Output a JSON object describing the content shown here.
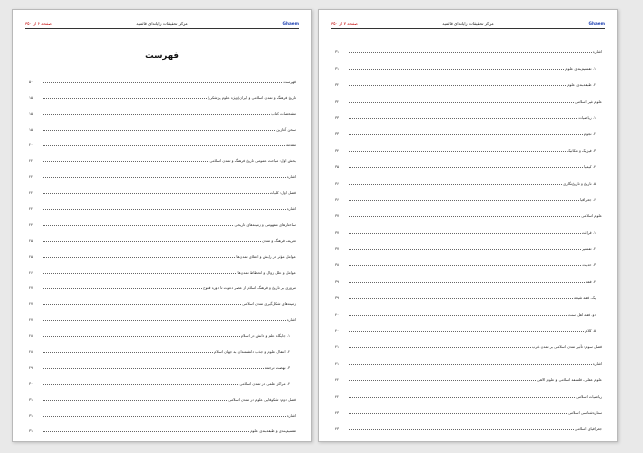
{
  "left_page": {
    "header": {
      "page_label": "صفحه ۶ از ۳۵۰",
      "title": "مرکز تحقیقات رایانه‌ای قائمیه",
      "brand": "Ghaem"
    },
    "toc_title": "فهرست",
    "entries": [
      {
        "text": "فهرست",
        "page": "۵۰"
      },
      {
        "text": "تاریخ فرهنگ و تمدن اسلامی و ایران(ویژه علوم پزشکی)",
        "page": "۱۵"
      },
      {
        "text": "مشخصات کتاب",
        "page": "۱۵"
      },
      {
        "text": "سخن آغازین",
        "page": "۱۵"
      },
      {
        "text": "مقدمه",
        "page": "۲۰"
      },
      {
        "text": "بخش اول: مباحث عمومی تاریخ فرهنگ و تمدن اسلامی",
        "page": "۲۲"
      },
      {
        "text": "اشاره",
        "page": "۲۲"
      },
      {
        "text": "فصل اول: کلیات",
        "page": "۲۲"
      },
      {
        "text": "اشاره",
        "page": "۲۲"
      },
      {
        "text": "ساختارهای مفهومی و زمینه‌های تاریخی",
        "page": "۲۴"
      },
      {
        "text": "تعریف فرهنگ و تمدن",
        "page": "۲۵"
      },
      {
        "text": "عوامل مؤثر در رابش و اعتلای تمدن‌ها",
        "page": "۲۵"
      },
      {
        "text": "عوامل و علل زوال و انحطاط تمدن‌ها",
        "page": "۲۶"
      },
      {
        "text": "مروری بر تاریخ و فرهنگ اسلام از عصر دعوت تا دوره فتوح",
        "page": "۲۷"
      },
      {
        "text": "زمینه‌های شکل‌گیری تمدن اسلامی",
        "page": "۲۷"
      },
      {
        "text": "اشاره",
        "page": "۲۷"
      },
      {
        "text": "۱. جایگاه علم و دانش در اسلام",
        "page": "۲۸"
      },
      {
        "text": "۲. انتقال علوم و جذب دانشمندان به جهان اسلام",
        "page": "۲۸"
      },
      {
        "text": "۳. نهضت ترجمه",
        "page": "۲۹"
      },
      {
        "text": "۴. مراکز علمی در تمدن اسلامی",
        "page": "۳۰"
      },
      {
        "text": "فصل دوم: شکوفایی علوم در تمدن اسلامی",
        "page": "۳۱"
      },
      {
        "text": "اشاره",
        "page": "۳۱"
      },
      {
        "text": "تقسیم‌بندی و طبقه‌بندی علوم",
        "page": "۳۱"
      }
    ]
  },
  "right_page": {
    "header": {
      "page_label": "صفحه ۷ از ۳۵۰",
      "title": "مرکز تحقیقات رایانه‌ای قائمیه",
      "brand": "Ghaem"
    },
    "entries": [
      {
        "text": "اشاره",
        "page": "۳۱"
      },
      {
        "text": "۱. تقسیم‌بندی علوم",
        "page": "۳۱"
      },
      {
        "text": "۲. طبقه‌بندی علوم",
        "page": "۳۲"
      },
      {
        "text": "علوم غیر اسلامی",
        "page": "۳۲"
      },
      {
        "text": "۱. ریاضیات",
        "page": "۳۳"
      },
      {
        "text": "۲. نجوم",
        "page": "۳۳"
      },
      {
        "text": "۳. فیزیک و مکانیک",
        "page": "۳۴"
      },
      {
        "text": "۴. کیمیا",
        "page": "۳۵"
      },
      {
        "text": "۵. تاریخ و تاریخ‌نگاری",
        "page": "۳۶"
      },
      {
        "text": "۶. جغرافیا",
        "page": "۳۶"
      },
      {
        "text": "علوم اسلامی",
        "page": "۳۷"
      },
      {
        "text": "۱. قرائت",
        "page": "۳۷"
      },
      {
        "text": "۲. تفسیر",
        "page": "۳۷"
      },
      {
        "text": "۳. حدیث",
        "page": "۳۸"
      },
      {
        "text": "۴. فقه",
        "page": "۳۹"
      },
      {
        "text": "یک. فقه شیعه",
        "page": "۳۹"
      },
      {
        "text": "دو. فقه اهل سنت",
        "page": "۴۰"
      },
      {
        "text": "۵. کلام",
        "page": "۴۰"
      },
      {
        "text": "فصل سوم: تأثیر تمدن اسلامی بر تمدن غرب",
        "page": "۴۱"
      },
      {
        "text": "اشاره",
        "page": "۴۱"
      },
      {
        "text": "علوم عقلی، فلسفه اسلامی و علوم الاهی",
        "page": "۴۲"
      },
      {
        "text": "ریاضیات اسلامی",
        "page": "۴۲"
      },
      {
        "text": "ستاره‌شناسی اسلامی",
        "page": "۴۳"
      },
      {
        "text": "جغرافیای اسلامی",
        "page": "۴۳"
      }
    ]
  }
}
